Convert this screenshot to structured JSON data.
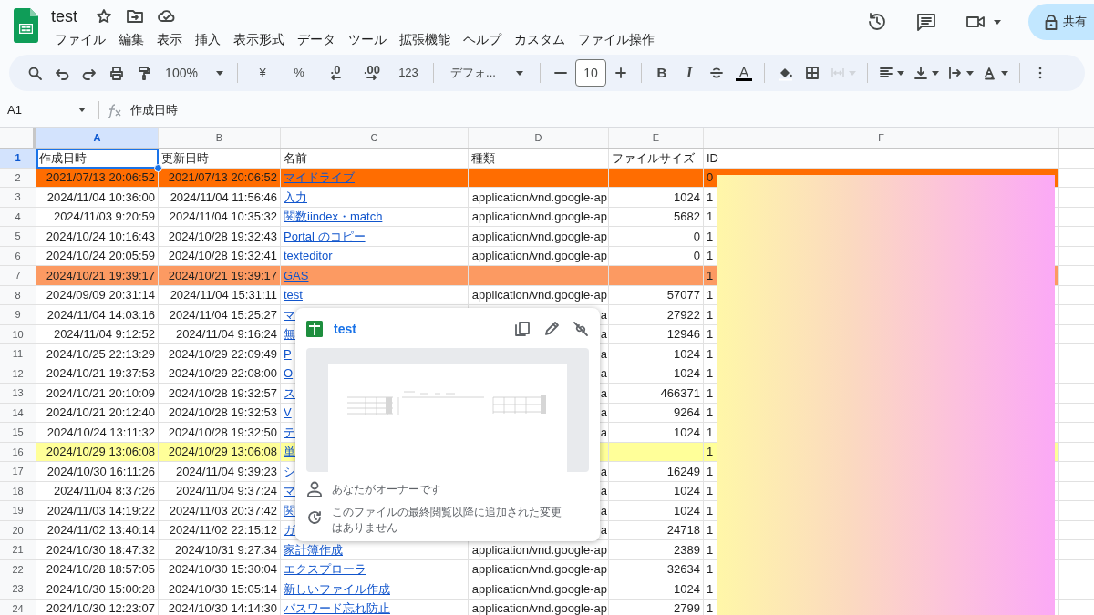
{
  "document": {
    "title": "test"
  },
  "menu": [
    "ファイル",
    "編集",
    "表示",
    "挿入",
    "表示形式",
    "データ",
    "ツール",
    "拡張機能",
    "ヘルプ",
    "カスタム",
    "ファイル操作"
  ],
  "share_button": {
    "label": "共有"
  },
  "toolbar": [
    {
      "kind": "search",
      "disabled": false
    },
    {
      "kind": "undo",
      "disabled": false
    },
    {
      "kind": "redo",
      "disabled": false
    },
    {
      "kind": "print",
      "disabled": false
    },
    {
      "kind": "paint_format",
      "disabled": false
    },
    {
      "kind": "zoom",
      "label": "100%",
      "disabled": false
    },
    {
      "kind": "separator"
    },
    {
      "kind": "text",
      "label": "¥",
      "disabled": false
    },
    {
      "kind": "text",
      "label": "%",
      "disabled": false
    },
    {
      "kind": "decimal_less",
      "label": ".0",
      "disabled": false
    },
    {
      "kind": "decimal_more",
      "label": ".00",
      "disabled": false
    },
    {
      "kind": "text",
      "label": "123",
      "disabled": false
    },
    {
      "kind": "separator"
    },
    {
      "kind": "font",
      "label": "デフォ...",
      "disabled": false
    },
    {
      "kind": "separator"
    },
    {
      "kind": "minus",
      "disabled": false
    },
    {
      "kind": "size",
      "label": "10",
      "disabled": false
    },
    {
      "kind": "plus",
      "disabled": false
    },
    {
      "kind": "separator"
    },
    {
      "kind": "bold",
      "label": "B",
      "disabled": false
    },
    {
      "kind": "italic",
      "label": "I",
      "disabled": false
    },
    {
      "kind": "strike",
      "disabled": false
    },
    {
      "kind": "text_color",
      "label": "A",
      "disabled": false
    },
    {
      "kind": "separator"
    },
    {
      "kind": "fill",
      "disabled": false
    },
    {
      "kind": "borders",
      "disabled": false
    },
    {
      "kind": "merge",
      "disabled": true
    },
    {
      "kind": "separator"
    },
    {
      "kind": "halign",
      "disabled": false
    },
    {
      "kind": "valign",
      "disabled": false
    },
    {
      "kind": "wrap",
      "disabled": false
    },
    {
      "kind": "rotate",
      "disabled": false
    },
    {
      "kind": "separator"
    },
    {
      "kind": "more",
      "disabled": false
    }
  ],
  "formula_bar": {
    "cell": "A1",
    "formula": "作成日時"
  },
  "columns": [
    {
      "letter": "A",
      "selected": true
    },
    {
      "letter": "B",
      "selected": false
    },
    {
      "letter": "C",
      "selected": false
    },
    {
      "letter": "D",
      "selected": false
    },
    {
      "letter": "E",
      "selected": false
    },
    {
      "letter": "F",
      "selected": false
    }
  ],
  "rows": [
    {
      "number": "1",
      "selected": true,
      "cells": [
        "作成日時",
        "更新日時",
        "名前",
        "種類",
        "ファイルサイズ",
        "ID"
      ]
    },
    {
      "number": "2",
      "selected": false,
      "color": "#ff6d01",
      "cells": [
        "2021/07/13 20:06:52",
        "2021/07/13 20:06:52",
        "マイドライブ",
        "",
        "",
        "0"
      ]
    },
    {
      "number": "3",
      "selected": false,
      "cells": [
        "2024/11/04 10:36:00",
        "2024/11/04 11:56:46",
        "入力",
        "application/vnd.google-ap",
        "1024",
        "1"
      ]
    },
    {
      "number": "4",
      "selected": false,
      "cells": [
        "2024/11/03 9:20:59",
        "2024/11/04 10:35:32",
        "関数iindex・match",
        "application/vnd.google-ap",
        "5682",
        "1"
      ]
    },
    {
      "number": "5",
      "selected": false,
      "cells": [
        "2024/10/24 10:16:43",
        "2024/10/28 19:32:43",
        "Portal のコピー",
        "application/vnd.google-ap",
        "0",
        "1"
      ]
    },
    {
      "number": "6",
      "selected": false,
      "cells": [
        "2024/10/24 20:05:59",
        "2024/10/28 19:32:41",
        "texteditor",
        "application/vnd.google-ap",
        "0",
        "1"
      ]
    },
    {
      "number": "7",
      "selected": false,
      "color": "#fc9a62",
      "cells": [
        "2024/10/21 19:39:17",
        "2024/10/21 19:39:17",
        "GAS",
        "",
        "",
        "1"
      ]
    },
    {
      "number": "8",
      "selected": false,
      "cells": [
        "2024/09/09 20:31:14",
        "2024/11/04 15:31:11",
        "test",
        "application/vnd.google-ap",
        "57077",
        "1"
      ]
    },
    {
      "number": "9",
      "selected": false,
      "cells": [
        "2024/11/04 14:03:16",
        "2024/11/04 15:25:27",
        "マ",
        "a",
        "27922",
        "1"
      ]
    },
    {
      "number": "10",
      "selected": false,
      "cells": [
        "2024/11/04 9:12:52",
        "2024/11/04 9:16:24",
        "無",
        "a",
        "12946",
        "1"
      ]
    },
    {
      "number": "11",
      "selected": false,
      "cells": [
        "2024/10/25 22:13:29",
        "2024/10/29 22:09:49",
        "P",
        "a",
        "1024",
        "1"
      ]
    },
    {
      "number": "12",
      "selected": false,
      "cells": [
        "2024/10/21 19:37:53",
        "2024/10/29 22:08:00",
        "O",
        "a",
        "1024",
        "1"
      ]
    },
    {
      "number": "13",
      "selected": false,
      "cells": [
        "2024/10/21 20:10:09",
        "2024/10/28 19:32:57",
        "ス",
        "a",
        "466371",
        "1"
      ]
    },
    {
      "number": "14",
      "selected": false,
      "cells": [
        "2024/10/21 20:12:40",
        "2024/10/28 19:32:53",
        "V",
        "a",
        "9264",
        "1"
      ]
    },
    {
      "number": "15",
      "selected": false,
      "cells": [
        "2024/10/24 13:11:32",
        "2024/10/28 19:32:50",
        "テ",
        "a",
        "1024",
        "1"
      ]
    },
    {
      "number": "16",
      "selected": false,
      "color": "#ffff99",
      "cells": [
        "2024/10/29 13:06:08",
        "2024/10/29 13:06:08",
        "単",
        "",
        "",
        "1"
      ]
    },
    {
      "number": "17",
      "selected": false,
      "cells": [
        "2024/10/30 16:11:26",
        "2024/11/04 9:39:23",
        "シ",
        "a",
        "16249",
        "1"
      ]
    },
    {
      "number": "18",
      "selected": false,
      "cells": [
        "2024/11/04 8:37:26",
        "2024/11/04 9:37:24",
        "マ",
        "a",
        "1024",
        "1"
      ]
    },
    {
      "number": "19",
      "selected": false,
      "cells": [
        "2024/11/03 14:19:22",
        "2024/11/03 20:37:42",
        "関",
        "a",
        "1024",
        "1"
      ]
    },
    {
      "number": "20",
      "selected": false,
      "cells": [
        "2024/11/02 13:40:14",
        "2024/11/02 22:15:12",
        "ガ",
        "a",
        "24718",
        "1"
      ]
    },
    {
      "number": "21",
      "selected": false,
      "cells": [
        "2024/10/30 18:47:32",
        "2024/10/31 9:27:34",
        "家計簿作成",
        "application/vnd.google-ap",
        "2389",
        "1"
      ]
    },
    {
      "number": "22",
      "selected": false,
      "cells": [
        "2024/10/28 18:57:05",
        "2024/10/30 15:30:04",
        "エクスプローラ",
        "application/vnd.google-ap",
        "32634",
        "1"
      ]
    },
    {
      "number": "23",
      "selected": false,
      "cells": [
        "2024/10/30 15:00:28",
        "2024/10/30 15:05:14",
        "新しいファイル作成",
        "application/vnd.google-ap",
        "1024",
        "1"
      ]
    },
    {
      "number": "24",
      "selected": false,
      "cells": [
        "2024/10/30 12:23:07",
        "2024/10/30 14:14:30",
        "パスワード忘れ防止",
        "application/vnd.google-ap",
        "2799",
        "1"
      ]
    }
  ],
  "link_popup": {
    "title": "test",
    "owner_text": "あなたがオーナーです",
    "changes_text": "このファイルの最終閲覧以降に追加された変更はありません"
  }
}
